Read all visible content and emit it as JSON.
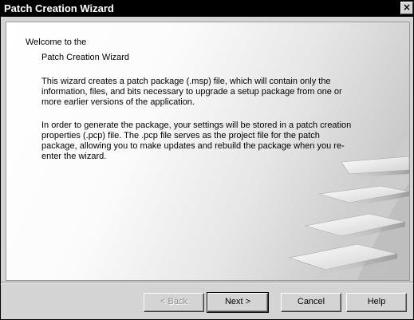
{
  "window": {
    "title": "Patch Creation Wizard",
    "close_glyph": "×"
  },
  "content": {
    "welcome": "Welcome to the",
    "wizard_name": "Patch Creation Wizard",
    "paragraph1": "This wizard creates a patch package (.msp) file, which will contain only the information, files, and bits necessary to upgrade a setup package from one or more earlier versions of the application.",
    "paragraph2": "In order to generate the package, your settings will be stored in a patch creation properties (.pcp) file. The .pcp file serves as the project file for the patch package, allowing you to make updates and rebuild the package when you re-enter the wizard."
  },
  "buttons": {
    "back": "< Back",
    "next": "Next >",
    "cancel": "Cancel",
    "help": "Help"
  },
  "colors": {
    "titlebar": "#000000",
    "dialog_face": "#d4d4d4",
    "disabled_text": "#8e8e8e"
  },
  "icons": {
    "close": "close-icon"
  }
}
